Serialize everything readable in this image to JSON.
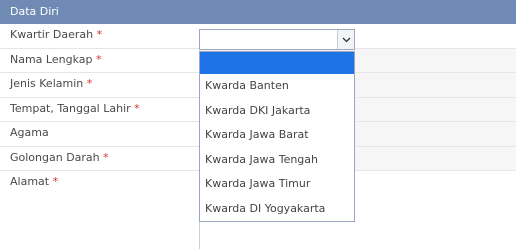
{
  "section": {
    "title": "Data Diri"
  },
  "fields": [
    {
      "label": "Kwartir Daerah",
      "required": "*"
    },
    {
      "label": "Nama Lengkap",
      "required": "*"
    },
    {
      "label": "Jenis Kelamin",
      "required": "*"
    },
    {
      "label": "Tempat, Tanggal Lahir",
      "required": "*"
    },
    {
      "label": "Agama",
      "required": ""
    },
    {
      "label": "Golongan Darah",
      "required": "*"
    },
    {
      "label": "Alamat",
      "required": "*"
    }
  ],
  "kwartir_select": {
    "value": "",
    "options": [
      "",
      "Kwarda Banten",
      "Kwarda DKI Jakarta",
      "Kwarda Jawa Barat",
      "Kwarda Jawa Tengah",
      "Kwarda Jawa Timur",
      "Kwarda DI Yogyakarta"
    ],
    "highlighted_index": 0
  },
  "colors": {
    "header_bg": "#6f8ab4",
    "highlight": "#1e73e6",
    "required": "#cc3333"
  }
}
